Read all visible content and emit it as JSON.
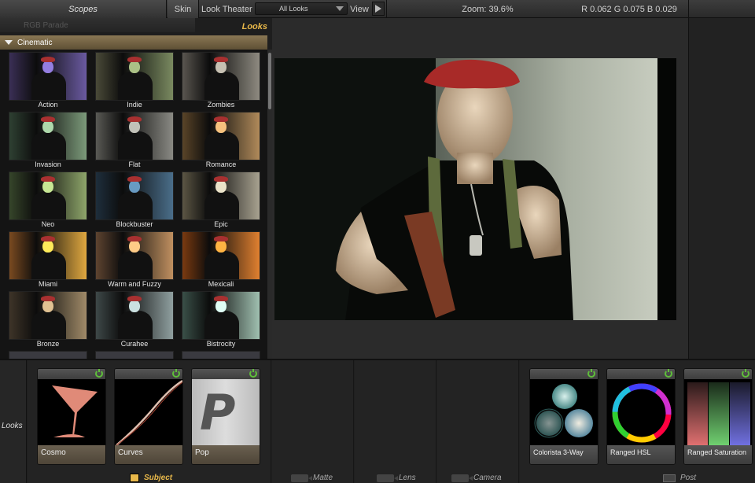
{
  "topbar": {
    "scopes_tab": "Scopes",
    "skin_tab": "Skin",
    "look_theater_label": "Look Theater",
    "looks_dropdown_value": "All Looks",
    "view_label": "View",
    "zoom_text": "Zoom:  39.6%",
    "rgb_text": "R 0.062   G 0.075   B 0.029"
  },
  "left_panel": {
    "rgb_parade_label": "RGB Parade",
    "looks_title": "Looks",
    "category": "Cinematic",
    "looks": [
      {
        "label": "Action",
        "tint": "#6a5aa0",
        "bg": "#3a2f55"
      },
      {
        "label": "Indie",
        "tint": "#7a8a60",
        "bg": "#4a4a38"
      },
      {
        "label": "Zombies",
        "tint": "#8e8a80",
        "bg": "#5a5650"
      },
      {
        "label": "Invasion",
        "tint": "#7c9a7a",
        "bg": "#2e4032"
      },
      {
        "label": "Flat",
        "tint": "#8a8a84",
        "bg": "#5a5a55"
      },
      {
        "label": "Romance",
        "tint": "#b08a5a",
        "bg": "#5a4428"
      },
      {
        "label": "Neo",
        "tint": "#8ea56a",
        "bg": "#36452a"
      },
      {
        "label": "Blockbuster",
        "tint": "#4a6e8a",
        "bg": "#1e2e3c"
      },
      {
        "label": "Epic",
        "tint": "#a8a290",
        "bg": "#5c5644"
      },
      {
        "label": "Miami",
        "tint": "#e0a840",
        "bg": "#7a4a20"
      },
      {
        "label": "Warm and Fuzzy",
        "tint": "#c09060",
        "bg": "#5e4430"
      },
      {
        "label": "Mexicali",
        "tint": "#e08030",
        "bg": "#7a3a10"
      },
      {
        "label": "Bronze",
        "tint": "#a08a68",
        "bg": "#3e3428"
      },
      {
        "label": "Curahee",
        "tint": "#90a0a0",
        "bg": "#3e4848"
      },
      {
        "label": "Bistrocity",
        "tint": "#a0c0b0",
        "bg": "#3a5048"
      }
    ]
  },
  "bottom": {
    "looks_label": "Looks",
    "stages": {
      "subject": "Subject",
      "matte": "Matte",
      "lens": "Lens",
      "camera": "Camera",
      "post": "Post"
    },
    "subject_tools": [
      "Cosmo",
      "Curves",
      "Pop"
    ],
    "post_tools": [
      "Colorista 3-Way",
      "Ranged HSL",
      "Ranged Saturation"
    ],
    "pop_letter": "P"
  }
}
